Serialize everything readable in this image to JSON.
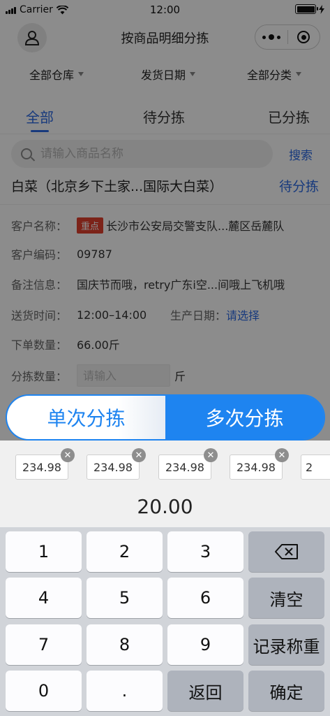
{
  "status_bar": {
    "carrier": "Carrier",
    "time": "12:00"
  },
  "nav": {
    "title": "按商品明细分拣"
  },
  "filters": [
    {
      "label": "全部仓库"
    },
    {
      "label": "发货日期"
    },
    {
      "label": "全部分类"
    }
  ],
  "tabs": [
    {
      "label": "全部"
    },
    {
      "label": "待分拣"
    },
    {
      "label": "已分拣"
    }
  ],
  "search": {
    "placeholder": "请输入商品名称",
    "button": "搜索"
  },
  "product": {
    "name": "白菜（北京乡下土家...国际大白菜）",
    "status": "待分拣"
  },
  "details": {
    "customer_name_label": "客户名称：",
    "customer_tag": "重点",
    "customer_name": "长沙市公安局交警支队...麓区岳麓队",
    "customer_code_label": "客户编码：",
    "customer_code": "09787",
    "remark_label": "备注信息：",
    "remark": "国庆节而哦，retry广东i空...间哦上飞机哦",
    "delivery_time_label": "送货时间：",
    "delivery_time": "12:00–14:00",
    "production_date_label": "生产日期：",
    "production_date_action": "请选择",
    "order_qty_label": "下单数量：",
    "order_qty": "66.00斤",
    "sort_qty_label": "分拣数量：",
    "sort_qty_placeholder": "请输入",
    "sort_qty_unit": "斤"
  },
  "mode": {
    "single": "单次分拣",
    "multi": "多次分拣",
    "active": "multi"
  },
  "records": [
    "234.98",
    "234.98",
    "234.98",
    "234.98",
    "2"
  ],
  "total": "20.00",
  "keypad": {
    "k1": "1",
    "k2": "2",
    "k3": "3",
    "k4": "4",
    "k5": "5",
    "k6": "6",
    "k7": "7",
    "k8": "8",
    "k9": "9",
    "k0": "0",
    "dot": ".",
    "backspace_icon": "backspace-icon",
    "clear": "清空",
    "record_weight": "记录称重",
    "back": "返回",
    "confirm": "确定"
  }
}
